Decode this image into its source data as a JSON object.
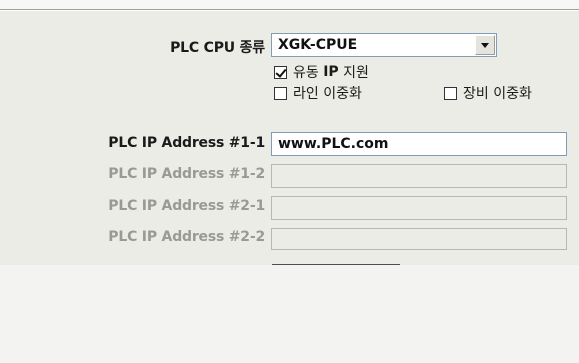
{
  "form": {
    "cpu_type_label": "PLC CPU 종류",
    "cpu_type_value": "XGK-CPUE",
    "checkboxes": [
      {
        "label_prefix": "유동 ",
        "label_bold": "IP",
        "label_suffix": " 지원",
        "checked": true
      },
      {
        "label": "라인 이중화",
        "checked": false
      },
      {
        "label": "장비 이중화",
        "checked": false
      }
    ],
    "addresses": [
      {
        "label": "PLC IP Address #1-1",
        "value": "www.PLC.com",
        "enabled": true
      },
      {
        "label": "PLC IP Address #1-2",
        "value": "",
        "enabled": false
      },
      {
        "label": "PLC IP Address #2-1",
        "value": "",
        "enabled": false
      },
      {
        "label": "PLC IP Address #2-2",
        "value": "",
        "enabled": false
      }
    ]
  }
}
